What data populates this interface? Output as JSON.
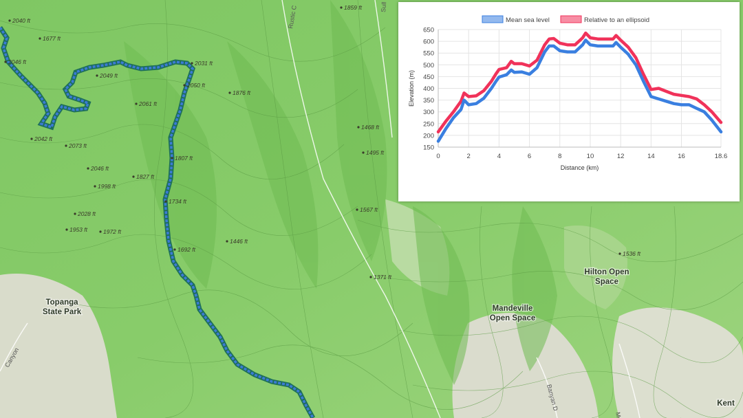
{
  "map": {
    "spot_elevations": [
      {
        "label": "2040 ft"
      },
      {
        "label": "1677 ft"
      },
      {
        "label": "2046 ft"
      },
      {
        "label": "2049 ft"
      },
      {
        "label": "2031 ft"
      },
      {
        "label": "2050 ft"
      },
      {
        "label": "1876 ft"
      },
      {
        "label": "2061 ft"
      },
      {
        "label": "2042 ft"
      },
      {
        "label": "2073 ft"
      },
      {
        "label": "2046 ft"
      },
      {
        "label": "1807 ft"
      },
      {
        "label": "1998 ft"
      },
      {
        "label": "1827 ft"
      },
      {
        "label": "1734 ft"
      },
      {
        "label": "2028 ft"
      },
      {
        "label": "1953 ft"
      },
      {
        "label": "1972 ft"
      },
      {
        "label": "1692 ft"
      },
      {
        "label": "1446 ft"
      },
      {
        "label": "1859 ft"
      },
      {
        "label": "1468 ft"
      },
      {
        "label": "1495 ft"
      },
      {
        "label": "1567 ft"
      },
      {
        "label": "1371 ft"
      },
      {
        "label": "1536 ft"
      }
    ],
    "places": [
      {
        "lines": [
          "Topanga",
          "State Park"
        ]
      },
      {
        "lines": [
          "Mandeville",
          "Open Space"
        ]
      },
      {
        "lines": [
          "Hilton Open",
          "Space"
        ]
      },
      {
        "lines": [
          "Kent"
        ]
      }
    ],
    "roads": [
      "Rustic C",
      "Canyon",
      "Banyan D",
      "Mo",
      "Sull"
    ],
    "colors": {
      "terrain": "#8fcf6f",
      "route_fill": "#3b7bd6",
      "route_casing": "#1f6f5a"
    }
  },
  "chart_data": {
    "type": "line",
    "title": "",
    "xlabel": "Distance (km)",
    "ylabel": "Elevation (m)",
    "xlim": [
      0,
      18.6
    ],
    "ylim": [
      150,
      650
    ],
    "x_ticks": [
      "0",
      "2",
      "4",
      "6",
      "8",
      "10",
      "12",
      "14",
      "16",
      "18.6"
    ],
    "y_ticks": [
      "150",
      "200",
      "250",
      "300",
      "350",
      "400",
      "450",
      "500",
      "550",
      "600",
      "650"
    ],
    "grid": true,
    "legend_position": "top-center",
    "x": [
      0,
      0.5,
      1,
      1.5,
      1.7,
      2,
      2.5,
      3,
      3.5,
      3.8,
      4,
      4.5,
      4.8,
      5,
      5.5,
      6,
      6.5,
      7,
      7.3,
      7.6,
      8,
      8.5,
      9,
      9.5,
      9.7,
      10,
      10.5,
      11,
      11.5,
      11.7,
      12,
      12.5,
      13,
      13.5,
      14,
      14.5,
      15,
      15.5,
      16,
      16.5,
      17,
      17.5,
      18,
      18.6
    ],
    "series": [
      {
        "name": "Mean sea level",
        "color": "#3a7fe0",
        "values": [
          175,
          228,
          275,
          310,
          350,
          330,
          335,
          358,
          400,
          430,
          448,
          458,
          478,
          468,
          470,
          460,
          488,
          555,
          580,
          580,
          560,
          555,
          555,
          585,
          605,
          585,
          580,
          580,
          580,
          595,
          575,
          545,
          500,
          430,
          365,
          355,
          345,
          335,
          330,
          330,
          315,
          300,
          265,
          215
        ]
      },
      {
        "name": "Relative to an ellipsoid",
        "color": "#f0325a",
        "values": [
          215,
          260,
          300,
          345,
          380,
          365,
          368,
          390,
          430,
          462,
          480,
          488,
          515,
          505,
          505,
          495,
          520,
          585,
          610,
          612,
          592,
          585,
          585,
          615,
          635,
          615,
          610,
          610,
          610,
          625,
          605,
          575,
          530,
          460,
          395,
          400,
          387,
          375,
          370,
          365,
          355,
          330,
          300,
          255
        ]
      }
    ]
  }
}
